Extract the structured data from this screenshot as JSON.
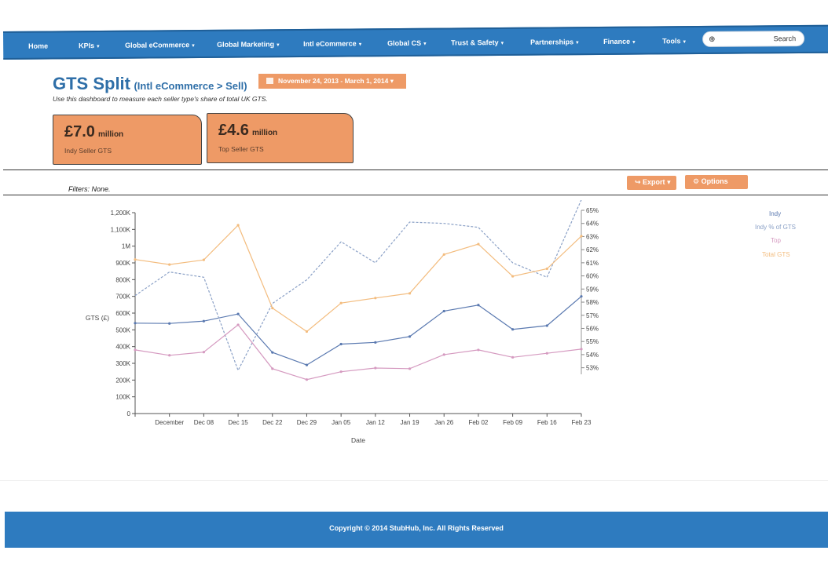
{
  "nav": {
    "items": [
      {
        "label": "Home",
        "caret": false
      },
      {
        "label": "KPIs",
        "caret": true
      },
      {
        "label": "Global eCommerce",
        "caret": true
      },
      {
        "label": "Global Marketing",
        "caret": true
      },
      {
        "label": "Intl eCommerce",
        "caret": true
      },
      {
        "label": "Global CS",
        "caret": true
      },
      {
        "label": "Trust & Safety",
        "caret": true
      },
      {
        "label": "Partnerships",
        "caret": true
      },
      {
        "label": "Finance",
        "caret": true
      },
      {
        "label": "Tools",
        "caret": true
      }
    ],
    "search_icon": "search-icon",
    "search_label": "Search"
  },
  "header": {
    "title": "GTS Split",
    "title_sub": "(Intl eCommerce > Sell)",
    "date_range": "November 24, 2013 - March 1, 2014",
    "subtitle": "Use this dashboard to measure each seller type's share of total UK GTS."
  },
  "kpis": [
    {
      "value": "£7.0",
      "unit": "million",
      "label": "Indy Seller GTS"
    },
    {
      "value": "£4.6",
      "unit": "million",
      "label": "Top Seller GTS"
    }
  ],
  "filters": "Filters: None.",
  "toolbar": {
    "export_label": "Export",
    "options_label": "Options"
  },
  "colors": {
    "brand": "#2e7bbf",
    "accent": "#ee9a66",
    "indy": "#5a79b0",
    "indy_pct": "#8aa0c6",
    "top": "#d59ac0",
    "total": "#f3bc7e"
  },
  "chart_data": {
    "type": "line",
    "x": [
      "",
      "December",
      "Dec 08",
      "Dec 15",
      "Dec 22",
      "Dec 29",
      "Jan 05",
      "Jan 12",
      "Jan 19",
      "Jan 26",
      "Feb 02",
      "Feb 09",
      "Feb 16",
      "Feb 23"
    ],
    "xlabel": "Date",
    "ylabel": "GTS (£)",
    "ylim": [
      0,
      1200000
    ],
    "y_ticks": [
      "0",
      "100K",
      "200K",
      "300K",
      "400K",
      "500K",
      "600K",
      "700K",
      "800K",
      "900K",
      "1M",
      "1,100K",
      "1,200K"
    ],
    "y2lim": [
      52.5,
      65
    ],
    "y2_ticks": [
      "53%",
      "54%",
      "55%",
      "56%",
      "57%",
      "58%",
      "59%",
      "60%",
      "61%",
      "62%",
      "63%",
      "64%",
      "65%"
    ],
    "series": [
      {
        "name": "Indy",
        "axis": "left",
        "values": [
          540000,
          538000,
          552000,
          595000,
          365000,
          290000,
          415000,
          425000,
          460000,
          612000,
          648000,
          503000,
          525000,
          700000
        ]
      },
      {
        "name": "Indy % of GTS",
        "axis": "right",
        "values": [
          58.5,
          60.3,
          59.9,
          52.8,
          57.9,
          59.7,
          62.6,
          61.0,
          64.1,
          64.0,
          63.7,
          61.0,
          59.9,
          65.8
        ]
      },
      {
        "name": "Top",
        "axis": "left",
        "values": [
          380000,
          348000,
          367000,
          530000,
          268000,
          203000,
          250000,
          272000,
          268000,
          352000,
          380000,
          336000,
          360000,
          385000
        ]
      },
      {
        "name": "Total GTS",
        "axis": "left",
        "values": [
          920000,
          890000,
          918000,
          1125000,
          630000,
          490000,
          660000,
          690000,
          718000,
          950000,
          1012000,
          820000,
          865000,
          1060000
        ]
      }
    ],
    "legend": "right"
  },
  "footer": {
    "copyright": "Copyright © 2014 StubHub, Inc. All Rights Reserved"
  }
}
